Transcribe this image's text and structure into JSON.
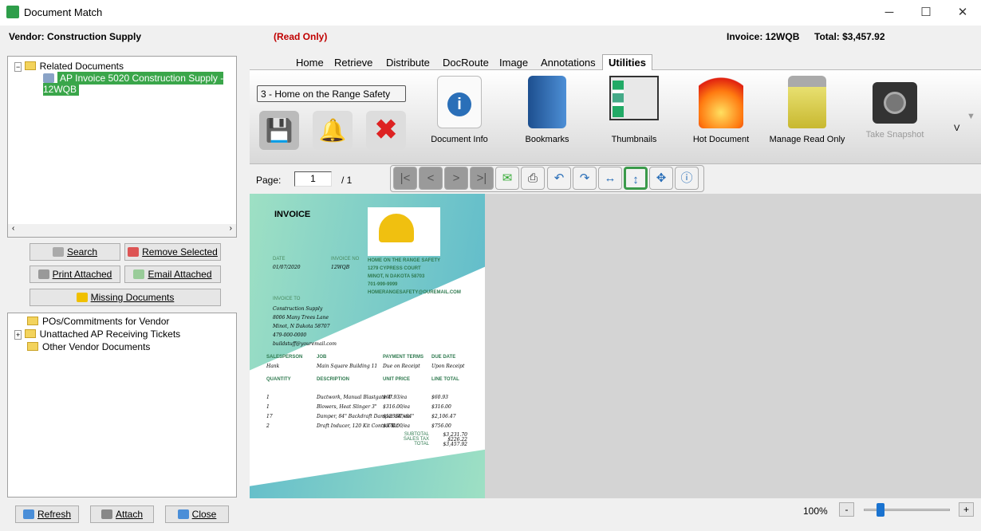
{
  "window": {
    "title": "Document Match",
    "minimize": "─",
    "maximize": "☐",
    "close": "✕"
  },
  "header": {
    "vendor": "Vendor: Construction Supply",
    "read_only": "(Read Only)",
    "invoice": "Invoice: 12WQB",
    "total": "Total: $3,457.92"
  },
  "related_tree": {
    "root": "Related Documents",
    "item": "AP Invoice 5020 Construction Supply - 12WQB"
  },
  "left_buttons": {
    "search": "Search",
    "remove_selected": "Remove Selected",
    "print_attached": "Print Attached",
    "email_attached": "Email Attached",
    "missing_documents": "Missing Documents"
  },
  "vendor_tree": [
    "POs/Commitments for Vendor",
    "Unattached AP Receiving Tickets",
    "Other Vendor Documents"
  ],
  "bottom_buttons": {
    "refresh": "Refresh",
    "attach": "Attach",
    "close": "Close"
  },
  "tabs": [
    "Home",
    "Retrieve",
    "Distribute",
    "DocRoute",
    "Image",
    "Annotations",
    "Utilities"
  ],
  "active_tab": "Utilities",
  "ribbon": {
    "dropdown_value": "3 - Home on the Range Safety",
    "buttons": [
      "Document Info",
      "Bookmarks",
      "Thumbnails",
      "Hot Document",
      "Manage Read Only",
      "Take Snapshot"
    ],
    "overflow": "V"
  },
  "pager": {
    "label": "Page:",
    "value": "1",
    "of": "/ 1"
  },
  "invoice": {
    "title": "INVOICE",
    "date_label": "DATE",
    "date": "01/07/2020",
    "no_label": "INVOICE NO",
    "no": "12WQB",
    "company": [
      "HOME ON THE RANGE SAFETY",
      "1279 CYPRESS COURT",
      "MINOT, N DAKOTA 58703",
      "701-999-9999",
      "HOMERANGESAFETY@OUREMAIL.COM"
    ],
    "to_label": "INVOICE TO",
    "to": [
      "Construction Supply",
      "8006 Many Trees Lane",
      "Minot, N Dakota 58707",
      "479-000-0000",
      "buildstuff@youremail.com"
    ],
    "head1": [
      "SALESPERSON",
      "JOB",
      "PAYMENT TERMS",
      "DUE DATE"
    ],
    "row1": [
      "Hank",
      "Main Square Building 11",
      "Due on Receipt",
      "Upon Receipt"
    ],
    "head2": [
      "QUANTITY",
      "DESCRIPTION",
      "UNIT PRICE",
      "LINE TOTAL"
    ],
    "lines": [
      [
        "1",
        "Ductwork, Manual Blastgate 4\"",
        "$60.93/ea",
        "$60.93"
      ],
      [
        "1",
        "Blowers, Heat Slinger 3\"",
        "$316.00/ea",
        "$316.00"
      ],
      [
        "17",
        "Damper, 84\" Backdraft Damper 84\"x84\"",
        "$123.91/ea",
        "$2,106.47"
      ],
      [
        "2",
        "Draft Inducer, 120 Kit Control Kit",
        "$378.00/ea",
        "$756.00"
      ]
    ],
    "totals": [
      [
        "SUBTOTAL",
        "$3,231.70"
      ],
      [
        "SALES TAX",
        "$226.22"
      ],
      [
        "TOTAL",
        "$3,457.92"
      ]
    ]
  },
  "zoom": {
    "level": "100%",
    "minus": "-",
    "plus": "+",
    "value_percent": 100
  }
}
